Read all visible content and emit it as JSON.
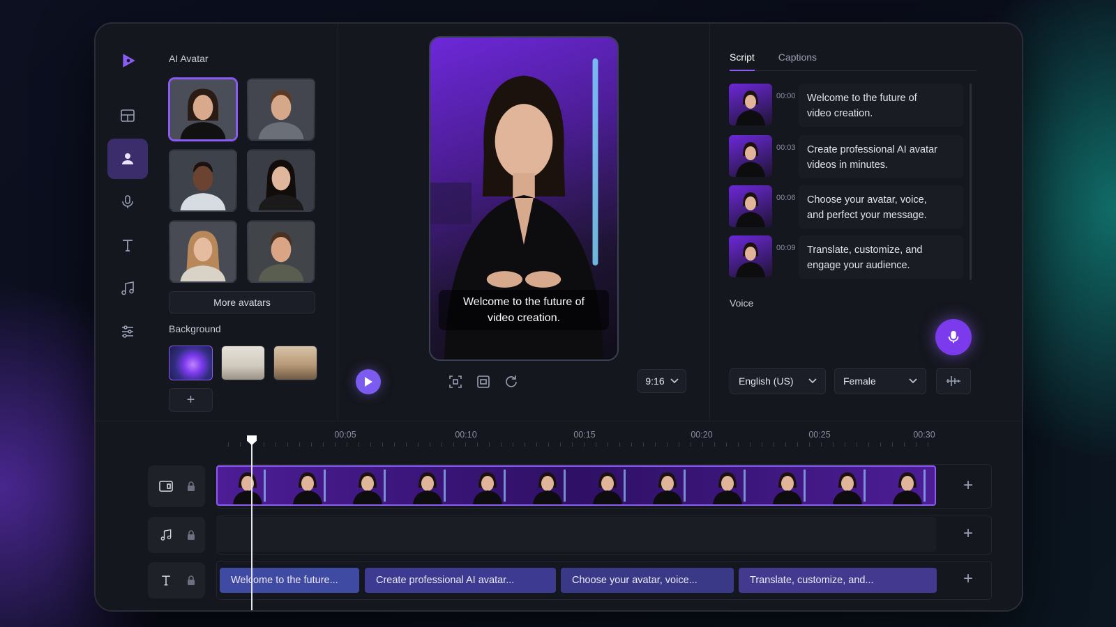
{
  "app": {
    "nav": [
      "logo",
      "templates",
      "avatar",
      "voice",
      "text",
      "music",
      "adjust"
    ],
    "active_nav": "avatar",
    "colors": {
      "accent": "#8b5cf6",
      "mic": "#7c3aed",
      "frame": "#15171e"
    }
  },
  "avatar_panel": {
    "title": "AI Avatar",
    "avatars": [
      {
        "name": "woman-dark-hair",
        "selected": true
      },
      {
        "name": "man-short-hair",
        "selected": false
      },
      {
        "name": "man-dark-skin",
        "selected": false
      },
      {
        "name": "woman-asian",
        "selected": false
      },
      {
        "name": "woman-blonde",
        "selected": false
      },
      {
        "name": "man-smiling",
        "selected": false
      }
    ],
    "more_label": "More avatars",
    "background_title": "Background",
    "backgrounds": [
      "purple-swirl",
      "living-room",
      "bedroom"
    ],
    "add_label": "+"
  },
  "preview": {
    "caption_line1": "Welcome to the future of",
    "caption_line2": "video creation.",
    "ratio": "9:16"
  },
  "script_panel": {
    "tabs": [
      "Script",
      "Captions"
    ],
    "active_tab": "Script",
    "items": [
      {
        "time": "00:00",
        "line1": "Welcome to the future of",
        "line2": "video creation."
      },
      {
        "time": "00:03",
        "line1": "Create professional AI avatar",
        "line2": "videos in minutes."
      },
      {
        "time": "00:06",
        "line1": "Choose your avatar, voice,",
        "line2": "and perfect your message."
      },
      {
        "time": "00:09",
        "line1": "Translate, customize, and",
        "line2": "engage your audience."
      }
    ],
    "voice_title": "Voice",
    "language": "English (US)",
    "gender": "Female"
  },
  "timeline": {
    "marks": [
      "00:05",
      "00:10",
      "00:15",
      "00:20",
      "00:25",
      "00:30"
    ],
    "captions": [
      "Welcome to the future...",
      "Create professional AI avatar...",
      "Choose your avatar, voice...",
      "Translate, customize, and..."
    ],
    "add_label": "+"
  }
}
